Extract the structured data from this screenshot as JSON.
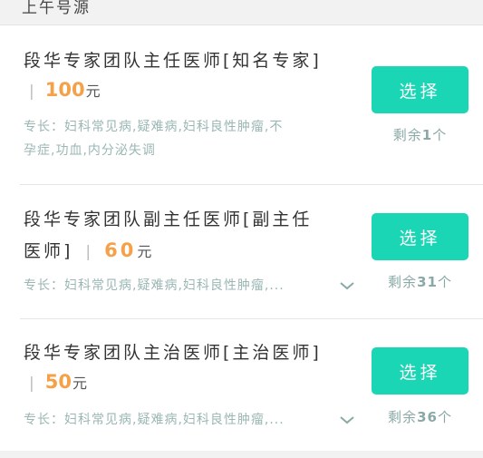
{
  "section": {
    "title": "上午号源"
  },
  "doctors": [
    {
      "name": "段华专家团队主任医师[知名专家]",
      "separator": "|",
      "price": "100",
      "unit": "元",
      "specialty_line1": "专长：妇科常见病,疑难病,妇科良性肿瘤,不",
      "specialty_line2": "孕症,功血,内分泌失调",
      "button": "选择",
      "remaining_prefix": "剩余",
      "remaining_count": "1",
      "remaining_suffix": "个"
    },
    {
      "name_line1": "段华专家团队副主任医师[副主任",
      "name_line2": "医师]",
      "separator": "|",
      "price": "60",
      "unit": "元",
      "specialty": "专长：妇科常见病,疑难病,妇科良性肿瘤,...",
      "button": "选择",
      "remaining_prefix": "剩余",
      "remaining_count": "31",
      "remaining_suffix": "个"
    },
    {
      "name": "段华专家团队主治医师[主治医师]",
      "separator": "|",
      "price": "50",
      "unit": "元",
      "specialty": "专长：妇科常见病,疑难病,妇科良性肿瘤,...",
      "button": "选择",
      "remaining_prefix": "剩余",
      "remaining_count": "36",
      "remaining_suffix": "个"
    }
  ],
  "icons": {
    "expand": "chevron-down-icon"
  },
  "colors": {
    "accent": "#1ad6b5",
    "price": "#f4a14a",
    "muted": "#9ab7b4"
  }
}
